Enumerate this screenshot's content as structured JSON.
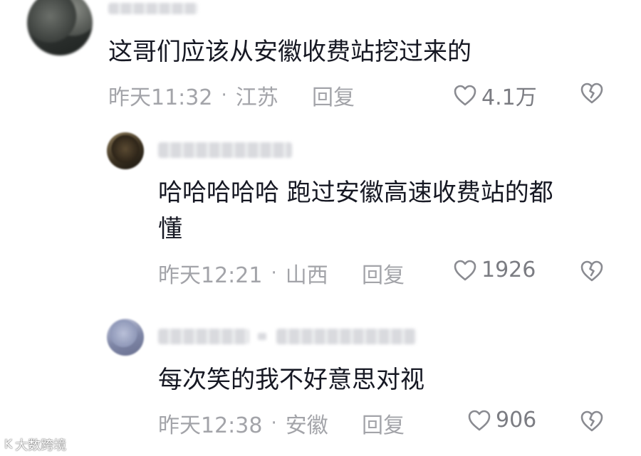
{
  "comments": [
    {
      "text": "这哥们应该从安徽收费站挖过来的",
      "time": "昨天11:32",
      "location": "江苏",
      "reply_label": "回复",
      "likes": "4.1万"
    },
    {
      "text_line1": "哈哈哈哈哈 跑过安徽高速收费站的都",
      "text_line2": "懂",
      "time": "昨天12:21",
      "location": "山西",
      "reply_label": "回复",
      "likes": "1926"
    },
    {
      "text": "每次笑的我不好意思对视",
      "time": "昨天12:38",
      "location": "安徽",
      "reply_label": "回复",
      "likes": "906"
    }
  ],
  "separator": "·",
  "watermark": {
    "logo": "K",
    "text": "大数跨境"
  },
  "icons": {
    "like": "heart-outline-icon",
    "dislike": "broken-heart-icon"
  },
  "colors": {
    "text": "#161823",
    "meta": "#a3a4a9",
    "count": "#7b7c82"
  }
}
